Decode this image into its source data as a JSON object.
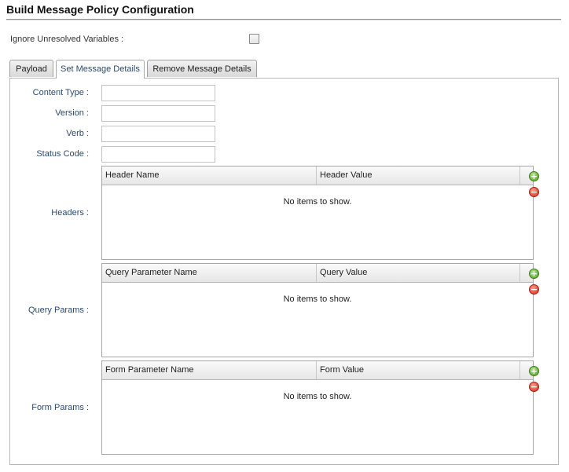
{
  "page": {
    "title": "Build Message Policy Configuration",
    "ignore_unresolved_label": "Ignore Unresolved Variables :",
    "ignore_unresolved_checked": false
  },
  "tabs": [
    {
      "label": "Payload",
      "active": false
    },
    {
      "label": "Set Message Details",
      "active": true
    },
    {
      "label": "Remove Message Details",
      "active": false
    }
  ],
  "fields": {
    "content_type": {
      "label": "Content Type :",
      "value": ""
    },
    "version": {
      "label": "Version :",
      "value": ""
    },
    "verb": {
      "label": "Verb :",
      "value": ""
    },
    "status_code": {
      "label": "Status Code :",
      "value": ""
    }
  },
  "grids": {
    "headers": {
      "label": "Headers :",
      "columns": [
        "Header Name",
        "Header Value"
      ],
      "empty_text": "No items to show."
    },
    "query_params": {
      "label": "Query Params :",
      "columns": [
        "Query Parameter Name",
        "Query Value"
      ],
      "empty_text": "No items to show."
    },
    "form_params": {
      "label": "Form Params :",
      "columns": [
        "Form Parameter Name",
        "Form Value"
      ],
      "empty_text": "No items to show."
    }
  },
  "icons": {
    "add": "plus-circle-icon",
    "remove": "minus-circle-icon"
  },
  "colors": {
    "label_blue": "#2b4a6f",
    "add_green": "#4e9b22",
    "remove_red": "#d42a1a"
  }
}
